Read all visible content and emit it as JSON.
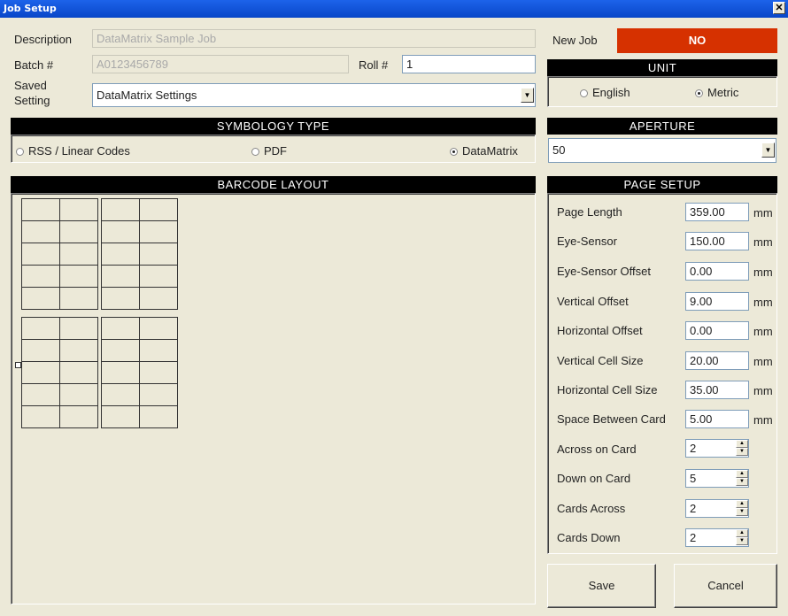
{
  "window": {
    "title": "Job Setup",
    "close_glyph": "✕"
  },
  "form": {
    "description_label": "Description",
    "description_value": "DataMatrix Sample Job",
    "batch_label": "Batch #",
    "batch_value": "A0123456789",
    "roll_label": "Roll #",
    "roll_value": "1",
    "saved_setting_label_1": "Saved",
    "saved_setting_label_2": "Setting",
    "saved_setting_value": "DataMatrix Settings"
  },
  "new_job": {
    "label": "New Job",
    "value": "NO",
    "color": "#d63100"
  },
  "unit": {
    "header": "UNIT",
    "options": [
      "English",
      "Metric"
    ],
    "selected": "Metric"
  },
  "symbology": {
    "header": "SYMBOLOGY TYPE",
    "options": [
      "RSS / Linear Codes",
      "PDF",
      "DataMatrix"
    ],
    "selected": "DataMatrix"
  },
  "aperture": {
    "header": "APERTURE",
    "value": "50"
  },
  "barcode_layout": {
    "header": "BARCODE LAYOUT"
  },
  "page_setup": {
    "header": "PAGE SETUP",
    "unit_suffix": "mm",
    "fields": [
      {
        "label": "Page Length",
        "value": "359.00"
      },
      {
        "label": "Eye-Sensor",
        "value": "150.00"
      },
      {
        "label": "Eye-Sensor Offset",
        "value": "0.00"
      },
      {
        "label": "Vertical Offset",
        "value": "9.00"
      },
      {
        "label": "Horizontal Offset",
        "value": "0.00"
      },
      {
        "label": "Vertical Cell Size",
        "value": "20.00"
      },
      {
        "label": "Horizontal Cell Size",
        "value": "35.00"
      },
      {
        "label": "Space Between Card",
        "value": "5.00"
      }
    ],
    "spinners": [
      {
        "label": "Across on Card",
        "value": "2"
      },
      {
        "label": "Down on Card",
        "value": "5"
      },
      {
        "label": "Cards Across",
        "value": "2"
      },
      {
        "label": "Cards Down",
        "value": "2"
      }
    ]
  },
  "buttons": {
    "save": "Save",
    "cancel": "Cancel"
  }
}
